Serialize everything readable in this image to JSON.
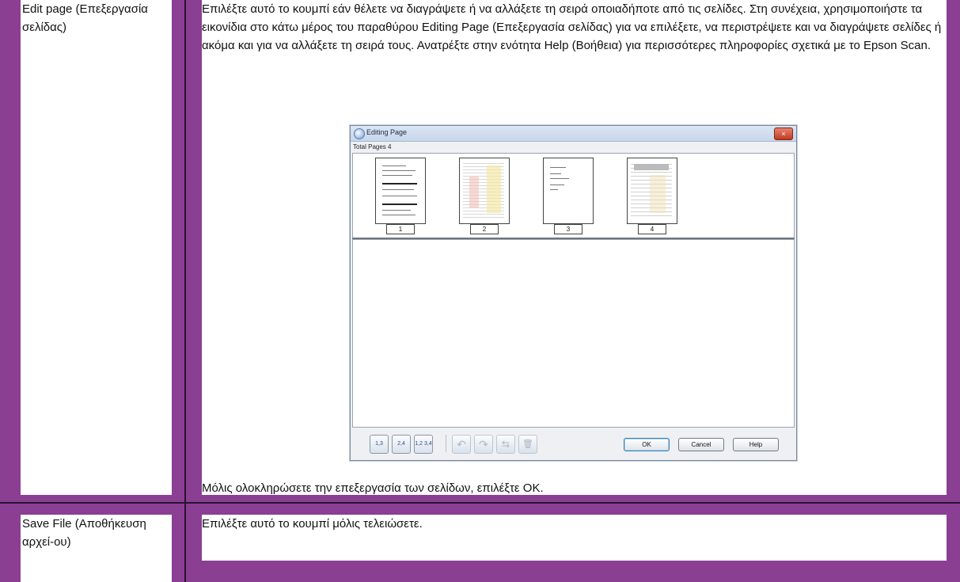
{
  "rows": [
    {
      "name_label": "Edit page (Επεξεργασία σελίδας)",
      "description_paragraphs": [
        "Επιλέξτε αυτό το κουμπί εάν θέλετε να διαγράψετε ή να αλλάξετε τη σειρά οποιαδήποτε από τις σελίδες. Στη συνέχεια, χρησιμοποιήστε τα εικονίδια στο κάτω μέρος του παραθύρου Editing Page (Επεξεργασία σελίδας) για να επιλέξετε, να περιστρέψετε και να διαγράψετε σελίδες ή ακόμα και για να αλλάξετε τη σειρά τους. Ανατρέξτε στην ενότητα Help (Βοήθεια) για περισσότερες πληροφορίες σχετικά με το Epson Scan."
      ],
      "after_text": "Μόλις ολοκληρώσετε την επεξεργασία των σελίδων, επιλέξτε OK."
    },
    {
      "name_label": "Save File (Αποθήκευση αρχεί-ου)",
      "description_paragraphs": [
        "Επιλέξτε αυτό το κουμπί μόλις τελειώσετε."
      ]
    }
  ],
  "dialog": {
    "title": "Editing Page",
    "close_glyph": "×",
    "total_pages": "Total Pages 4",
    "pages": [
      "1",
      "2",
      "3",
      "4"
    ],
    "toolbar_icons": [
      {
        "name": "select-odd-pages-icon",
        "glyph": "1,3",
        "enabled": true
      },
      {
        "name": "select-even-pages-icon",
        "glyph": "2,4",
        "enabled": true
      },
      {
        "name": "select-all-pages-icon",
        "glyph": "1,2 3,4",
        "enabled": true
      },
      {
        "name": "rotate-left-icon",
        "glyph": "↶",
        "enabled": false
      },
      {
        "name": "rotate-right-icon",
        "glyph": "↷",
        "enabled": false
      },
      {
        "name": "swap-pages-icon",
        "glyph": "⇆",
        "enabled": false
      },
      {
        "name": "delete-page-icon",
        "glyph": "🗑",
        "enabled": false
      }
    ],
    "buttons": {
      "ok": "OK",
      "cancel": "Cancel",
      "help": "Help"
    }
  },
  "colors": {
    "frame": "#8a3f93",
    "divider": "#2b1233",
    "cell_bg": "#ffffff"
  }
}
